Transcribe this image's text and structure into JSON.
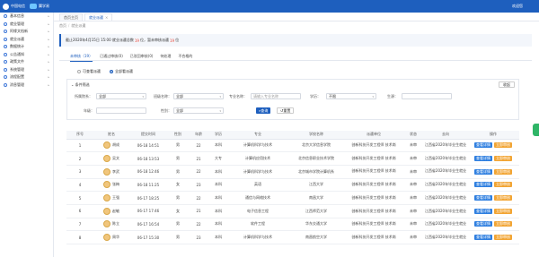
{
  "header": {
    "brand_left": "中国电信",
    "brand_right": "翼学易",
    "user": "欢迎您"
  },
  "sidebar": {
    "items": [
      {
        "label": "基本信息"
      },
      {
        "label": "就业管理"
      },
      {
        "label": "阿缘文档新"
      },
      {
        "label": "就业派遣"
      },
      {
        "label": "数据统计"
      },
      {
        "label": "公告通知"
      },
      {
        "label": "政策文件"
      },
      {
        "label": "系统管理"
      },
      {
        "label": "流程配置"
      },
      {
        "label": "消息管理"
      }
    ]
  },
  "tabs": [
    {
      "label": "首页主页"
    },
    {
      "label": "就业派遣"
    }
  ],
  "breadcrumb": {
    "home": "首页",
    "current": "就业派遣"
  },
  "notice": {
    "prefix": "截止2020年4月15日 15:00 就业派遣总数",
    "count1": "19",
    "mid": "位，暂未审核派遣",
    "count2": "19",
    "suffix": "位"
  },
  "subtabs": [
    {
      "label": "未审核（19）"
    },
    {
      "label": "已通过审核(0)"
    },
    {
      "label": "已驳回审核(0)"
    },
    {
      "label": "待处理"
    },
    {
      "label": "不合格的"
    }
  ],
  "radios": [
    {
      "label": "可查看派遣"
    },
    {
      "label": "全部看派遣"
    }
  ],
  "filter": {
    "title": "条件筛选",
    "collapse": "收起",
    "college_label": "所属院系：",
    "college_value": "全部",
    "class_label": "班级名称：",
    "class_value": "全部",
    "major_label": "专业名称：",
    "major_placeholder": "请输入专业名称",
    "degree_label": "学历：",
    "degree_value": "不限",
    "origin_label": "生源：",
    "year_label": "年级：",
    "gender_label": "性别：",
    "gender_value": "全部",
    "search_btn": "查询",
    "reset_btn": "重置"
  },
  "table": {
    "headers": [
      "序号",
      "姓名",
      "提交时间",
      "性别",
      "年龄",
      "学历",
      "专业",
      "学校名称",
      "派遣单位",
      "状态",
      "去向",
      "操作"
    ],
    "rows": [
      {
        "no": "1",
        "name": "胡成",
        "time": "06-18 14:51",
        "gender": "男",
        "age": "22",
        "degree": "本科",
        "major": "计算机科学与技术",
        "school": "北京大学信息学院",
        "unit": "创新科技开发工程师 技术岗",
        "status": "未审",
        "dest": "江西省2020年毕业生就业",
        "view": "查看详情",
        "approve": "立即审核"
      },
      {
        "no": "2",
        "name": "吴文",
        "time": "06-18 13:53",
        "gender": "男",
        "age": "21",
        "degree": "大专",
        "major": "计算机应用技术",
        "school": "北京信息职业技术学院",
        "unit": "创新科技开发工程师 技术岗",
        "status": "未审",
        "dest": "江西省2020年毕业生就业",
        "view": "查看详情",
        "approve": "立即审核"
      },
      {
        "no": "3",
        "name": "李武",
        "time": "06-18 12:46",
        "gender": "男",
        "age": "22",
        "degree": "本科",
        "major": "计算机科学与技术",
        "school": "北京城市学院计算机系",
        "unit": "创新科技开发工程师 技术岗",
        "status": "未审",
        "dest": "江西省2020年毕业生就业",
        "view": "查看详情",
        "approve": "立即审核"
      },
      {
        "no": "4",
        "name": "张梅",
        "time": "06-18 11:25",
        "gender": "女",
        "age": "23",
        "degree": "本科",
        "major": "英语",
        "school": "江西大学",
        "unit": "创新科技开发工程师 技术岗",
        "status": "未审",
        "dest": "江西省2020年毕业生就业",
        "view": "查看详情",
        "approve": "立即审核"
      },
      {
        "no": "5",
        "name": "王强",
        "time": "06-17 18:25",
        "gender": "男",
        "age": "22",
        "degree": "本科",
        "major": "通信与网络技术",
        "school": "南昌大学",
        "unit": "创新科技开发工程师 技术岗",
        "status": "未审",
        "dest": "江西省2020年毕业生就业",
        "view": "查看详情",
        "approve": "立即审核"
      },
      {
        "no": "6",
        "name": "赵敏",
        "time": "06-17 17:46",
        "gender": "女",
        "age": "21",
        "degree": "本科",
        "major": "电子信息工程",
        "school": "江西师范大学",
        "unit": "创新科技开发工程师 技术岗",
        "status": "未审",
        "dest": "江西省2020年毕业生就业",
        "view": "查看详情",
        "approve": "立即审核"
      },
      {
        "no": "7",
        "name": "陈立",
        "time": "06-17 16:54",
        "gender": "男",
        "age": "22",
        "degree": "本科",
        "major": "软件工程",
        "school": "华东交通大学",
        "unit": "创新科技开发工程师 技术岗",
        "status": "未审",
        "dest": "江西省2020年毕业生就业",
        "view": "查看详情",
        "approve": "立即审核"
      },
      {
        "no": "8",
        "name": "周华",
        "time": "06-17 15:30",
        "gender": "男",
        "age": "23",
        "degree": "本科",
        "major": "计算机科学与技术",
        "school": "南昌航空大学",
        "unit": "创新科技开发工程师 技术岗",
        "status": "未审",
        "dest": "江西省2020年毕业生就业",
        "view": "查看详情",
        "approve": "立即审核"
      }
    ]
  },
  "colors": {
    "primary": "#1e5fbe",
    "view_btn": "#2f7fe0",
    "approve_btn": "#f2a534",
    "highlight": "#e94b3c"
  }
}
